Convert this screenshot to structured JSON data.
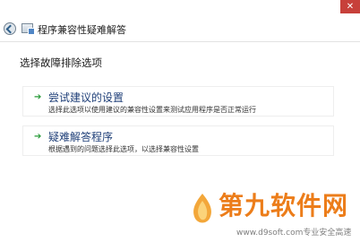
{
  "window": {
    "close_glyph": "✕"
  },
  "header": {
    "title": "程序兼容性疑难解答"
  },
  "section": {
    "title": "选择故障排除选项"
  },
  "options": [
    {
      "title": "尝试建议的设置",
      "description": "选择此选项以使用建议的兼容性设置来测试应用程序是否正常运行"
    },
    {
      "title": "疑难解答程序",
      "description": "根据遇到的问题选择此选项，以选择兼容性设置"
    }
  ],
  "watermark": {
    "brand": "第九软件网",
    "url": "www.d9soft.com专业安全高速"
  },
  "colors": {
    "close_red": "#c7403a",
    "link_blue": "#1f3f78",
    "arrow_green": "#2a9b3a",
    "watermark_orange": "#ec7d1a"
  },
  "icons": {
    "back": "back-arrow-icon",
    "app": "compatibility-troubleshooter-icon",
    "option_arrow": "green-arrow-icon",
    "logo": "d9soft-logo"
  }
}
